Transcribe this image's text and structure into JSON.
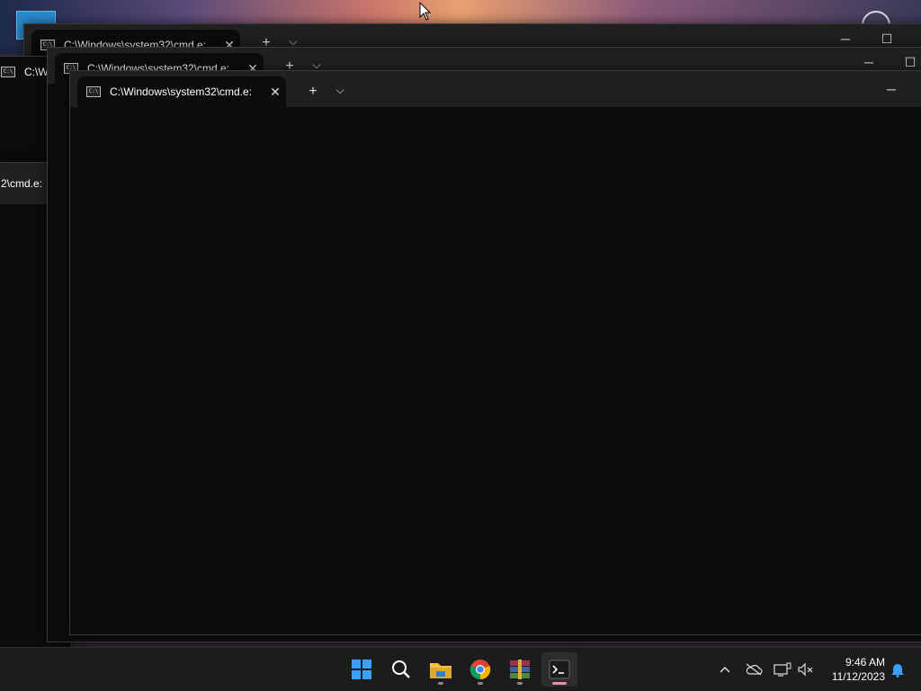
{
  "windows": [
    {
      "tab_title": "C:\\Windows\\system32\\cmd.e:",
      "new_tab": "+",
      "dropdown": "⌵",
      "minimize": "─",
      "maximize": "☐"
    },
    {
      "tab_title": "C:\\Windows\\system32\\cmd.e:",
      "new_tab": "+",
      "dropdown": "⌵",
      "minimize": "─",
      "maximize": "☐"
    },
    {
      "tab_title": "C:\\Windows\\system32\\cmd.e:",
      "new_tab": "+",
      "dropdown": "⌵",
      "minimize": "─"
    }
  ],
  "left_window_tab": "C:\\W",
  "bottom_left_tab": "2\\cmd.e:",
  "tab_close": "✕",
  "taskbar": {
    "apps": [
      {
        "name": "start",
        "icon": "windows-logo-icon"
      },
      {
        "name": "search",
        "icon": "search-icon"
      },
      {
        "name": "file-explorer",
        "icon": "folder-icon"
      },
      {
        "name": "chrome",
        "icon": "chrome-icon"
      },
      {
        "name": "winrar",
        "icon": "winrar-icon"
      },
      {
        "name": "terminal",
        "icon": "terminal-icon"
      }
    ],
    "tray": {
      "chevron": "^",
      "time": "9:46 AM",
      "date": "11/12/2023"
    }
  },
  "colors": {
    "terminal_bg": "#0c0c0c",
    "titlebar_bg": "#202020",
    "taskbar_bg": "#1c1c1c",
    "active_indicator": "#f28aa0"
  }
}
